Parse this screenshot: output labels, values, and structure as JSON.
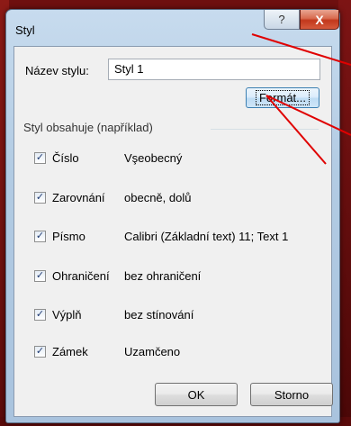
{
  "window": {
    "title": "Styl",
    "help_glyph": "?",
    "close_glyph": "X"
  },
  "name_field": {
    "label": "Název stylu:",
    "value": "Styl 1"
  },
  "format_button": {
    "label": "Formát..."
  },
  "group": {
    "legend": "Styl obsahuje (například)",
    "items": [
      {
        "label": "Číslo",
        "value": "Vşeobecný",
        "checked": true
      },
      {
        "label": "Zarovnání",
        "value": "obecně, dolů",
        "checked": true
      },
      {
        "label": "Písmo",
        "value": "Calibri (Základní text) 11; Text 1",
        "checked": true
      },
      {
        "label": "Ohraničení",
        "value": "bez ohraničení",
        "checked": true
      },
      {
        "label": "Výplň",
        "value": "bez stínování",
        "checked": true
      },
      {
        "label": "Zámek",
        "value": "Uzamčeno",
        "checked": true
      }
    ]
  },
  "buttons": {
    "ok": "OK",
    "cancel": "Storno"
  },
  "colors": {
    "background": "#7a0f10",
    "annotation_arrow": "#e00000"
  }
}
